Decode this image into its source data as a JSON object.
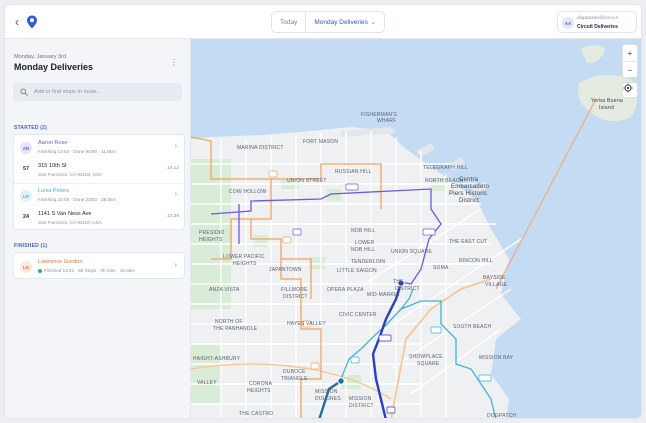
{
  "topbar": {
    "segments": [
      {
        "label": "Today"
      },
      {
        "label": "Monday Deliveries"
      }
    ],
    "caret": "⌄",
    "user": {
      "initials": "AA",
      "email": "dispatcher@circu.it",
      "org": "Circuit Deliveries"
    }
  },
  "sidebar": {
    "date": "Monday, January 3rd",
    "title": "Monday Deliveries",
    "search_placeholder": "Add or find stops in route...",
    "started_label": "STARTED (2)",
    "finished_label": "FINISHED (1)",
    "started": [
      {
        "initials": "AR",
        "name": "Aaron Rose",
        "status": "Finishing 14:54 · Done 94/59 · 11.6km",
        "stop_number": "57",
        "address": "315 10th St",
        "city": "San Francisco, CA 94103, USA",
        "time": "14:12"
      },
      {
        "initials": "LP",
        "name": "Luisa Peters",
        "status": "Finishing 15:05 · Done 23/63 · 28.5km",
        "stop_number": "24",
        "address": "1141 S Van Ness Ave",
        "city": "San Francisco, CA 94110, USA",
        "time": "14:35"
      }
    ],
    "finished": [
      {
        "initials": "LG",
        "name": "Lawrence Gordon",
        "status": "Finished 14:21 · 60 Stops · 3h 24m · 16.6km"
      }
    ]
  },
  "map": {
    "labels": [
      "FISHERMAN'S",
      "WHARF",
      "FORT MASON",
      "MARINA DISTRICT",
      "RUSSIAN HILL",
      "TELEGRAPH HILL",
      "NORTH BEACH",
      "UNION STREET",
      "COW HOLLOW",
      "Centra",
      "Embarcadero",
      "Piers Historic",
      "District",
      "PRESIDIO",
      "HEIGHTS",
      "NOB HILL",
      "THE EAST CUT",
      "LOWER",
      "NOB HILL",
      "UNION SQUARE",
      "LOWER PACIFIC",
      "HEIGHTS",
      "TENDERLOIN",
      "RINCON HILL",
      "JAPANTOWN",
      "LITTLE SAIGON",
      "SOMA",
      "THE",
      "DISTRICT",
      "BAYSIDE",
      "VILLAGE",
      "ANZA VISTA",
      "FILLMORE",
      "DISTRICT",
      "OPERA PLAZA",
      "MID-MARKET",
      "NORTH OF",
      "THE PANHANDLE",
      "HAYES VALLEY",
      "CIVIC CENTER",
      "SOUTH BEACH",
      "HAIGHT-ASHBURY",
      "SHOWPLACE",
      "SQUARE",
      "MISSION BAY",
      "VALLEY",
      "CORONA",
      "HEIGHTS",
      "DUBOCE",
      "TRIANGLE",
      "MISSION",
      "DOLORES",
      "MISSION",
      "DISTRICT",
      "THE CASTRO",
      "DOGPATCH",
      "Yerba Buena",
      "Island"
    ],
    "zoom_in": "+",
    "zoom_out": "−"
  },
  "colors": {
    "accent": "#2f5bd3",
    "route_orange": "#f0a460",
    "route_purple": "#6a5be0",
    "route_teal": "#3fb3d8",
    "route_navy": "#2c3fc4",
    "water": "#c4dcf3",
    "park": "#d9ecd7",
    "land": "#eef0f2"
  }
}
